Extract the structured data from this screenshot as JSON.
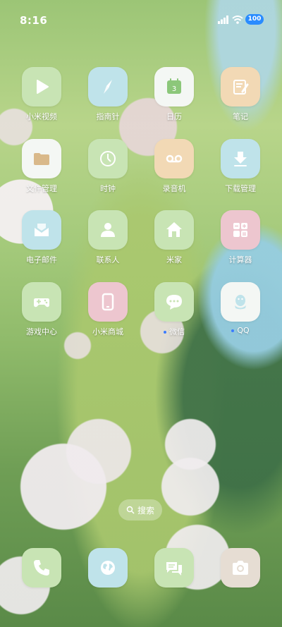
{
  "status": {
    "time": "8:16",
    "battery": "100"
  },
  "apps": [
    {
      "label": "小米视频",
      "icon": "play-icon"
    },
    {
      "label": "指南针",
      "icon": "compass-icon"
    },
    {
      "label": "日历",
      "icon": "calendar-icon",
      "day": "3"
    },
    {
      "label": "笔记",
      "icon": "notes-icon"
    },
    {
      "label": "文件管理",
      "icon": "folder-icon"
    },
    {
      "label": "时钟",
      "icon": "clock-icon"
    },
    {
      "label": "录音机",
      "icon": "recorder-icon"
    },
    {
      "label": "下载管理",
      "icon": "download-icon"
    },
    {
      "label": "电子邮件",
      "icon": "mail-icon"
    },
    {
      "label": "联系人",
      "icon": "contacts-icon"
    },
    {
      "label": "米家",
      "icon": "home-icon"
    },
    {
      "label": "计算器",
      "icon": "calculator-icon"
    },
    {
      "label": "游戏中心",
      "icon": "gamepad-icon"
    },
    {
      "label": "小米商城",
      "icon": "phone-device-icon"
    },
    {
      "label": "微信",
      "icon": "chat-bubble-icon"
    },
    {
      "label": "QQ",
      "icon": "qq-penguin-icon"
    }
  ],
  "search": {
    "label": "搜索"
  },
  "dock": [
    {
      "icon": "phone-icon"
    },
    {
      "icon": "browser-icon"
    },
    {
      "icon": "messages-icon"
    },
    {
      "icon": "camera-icon"
    }
  ],
  "colors": {
    "dot": "#3a7bff",
    "battery": "#2a8cff"
  }
}
